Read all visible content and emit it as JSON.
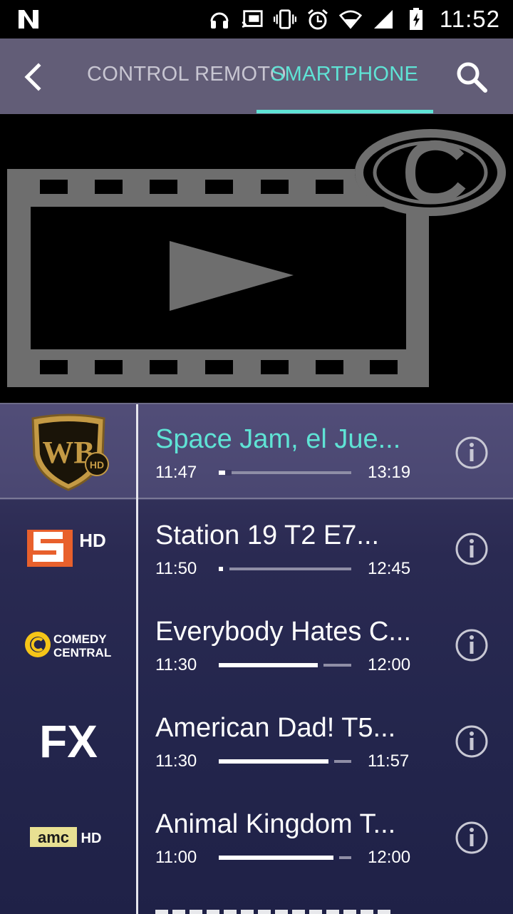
{
  "status_bar": {
    "time": "11:52",
    "icons": [
      "netflix-n-icon",
      "headphones-icon",
      "cast-icon",
      "vibrate-icon",
      "alarm-icon",
      "wifi-icon",
      "signal-icon",
      "battery-charging-icon"
    ]
  },
  "topbar": {
    "tabs": [
      {
        "label": "CONTROL REMOTO",
        "active": false
      },
      {
        "label": "SMARTPHONE",
        "active": true
      }
    ],
    "accent_color": "#5fe3d5"
  },
  "channels": [
    {
      "logo": "warner-bros-hd",
      "title": "Space Jam, el Jue...",
      "start": "11:47",
      "end": "13:19",
      "progress": 0.05,
      "active": true
    },
    {
      "logo": "sony-hd",
      "logo_text": "HD",
      "title": "Station 19 T2 E7...",
      "start": "11:50",
      "end": "12:45",
      "progress": 0.03,
      "active": false
    },
    {
      "logo": "comedy-central",
      "logo_text": "COMEDY\nCENTRAL",
      "title": "Everybody Hates C...",
      "start": "11:30",
      "end": "12:00",
      "progress": 0.75,
      "active": false
    },
    {
      "logo": "fx",
      "logo_text": "FX",
      "title": "American Dad! T5...",
      "start": "11:30",
      "end": "11:57",
      "progress": 0.83,
      "active": false
    },
    {
      "logo": "amc-hd",
      "logo_text": "amc",
      "logo_hd": "HD",
      "title": "Animal Kingdom T...",
      "start": "11:00",
      "end": "12:00",
      "progress": 0.87,
      "active": false
    }
  ]
}
